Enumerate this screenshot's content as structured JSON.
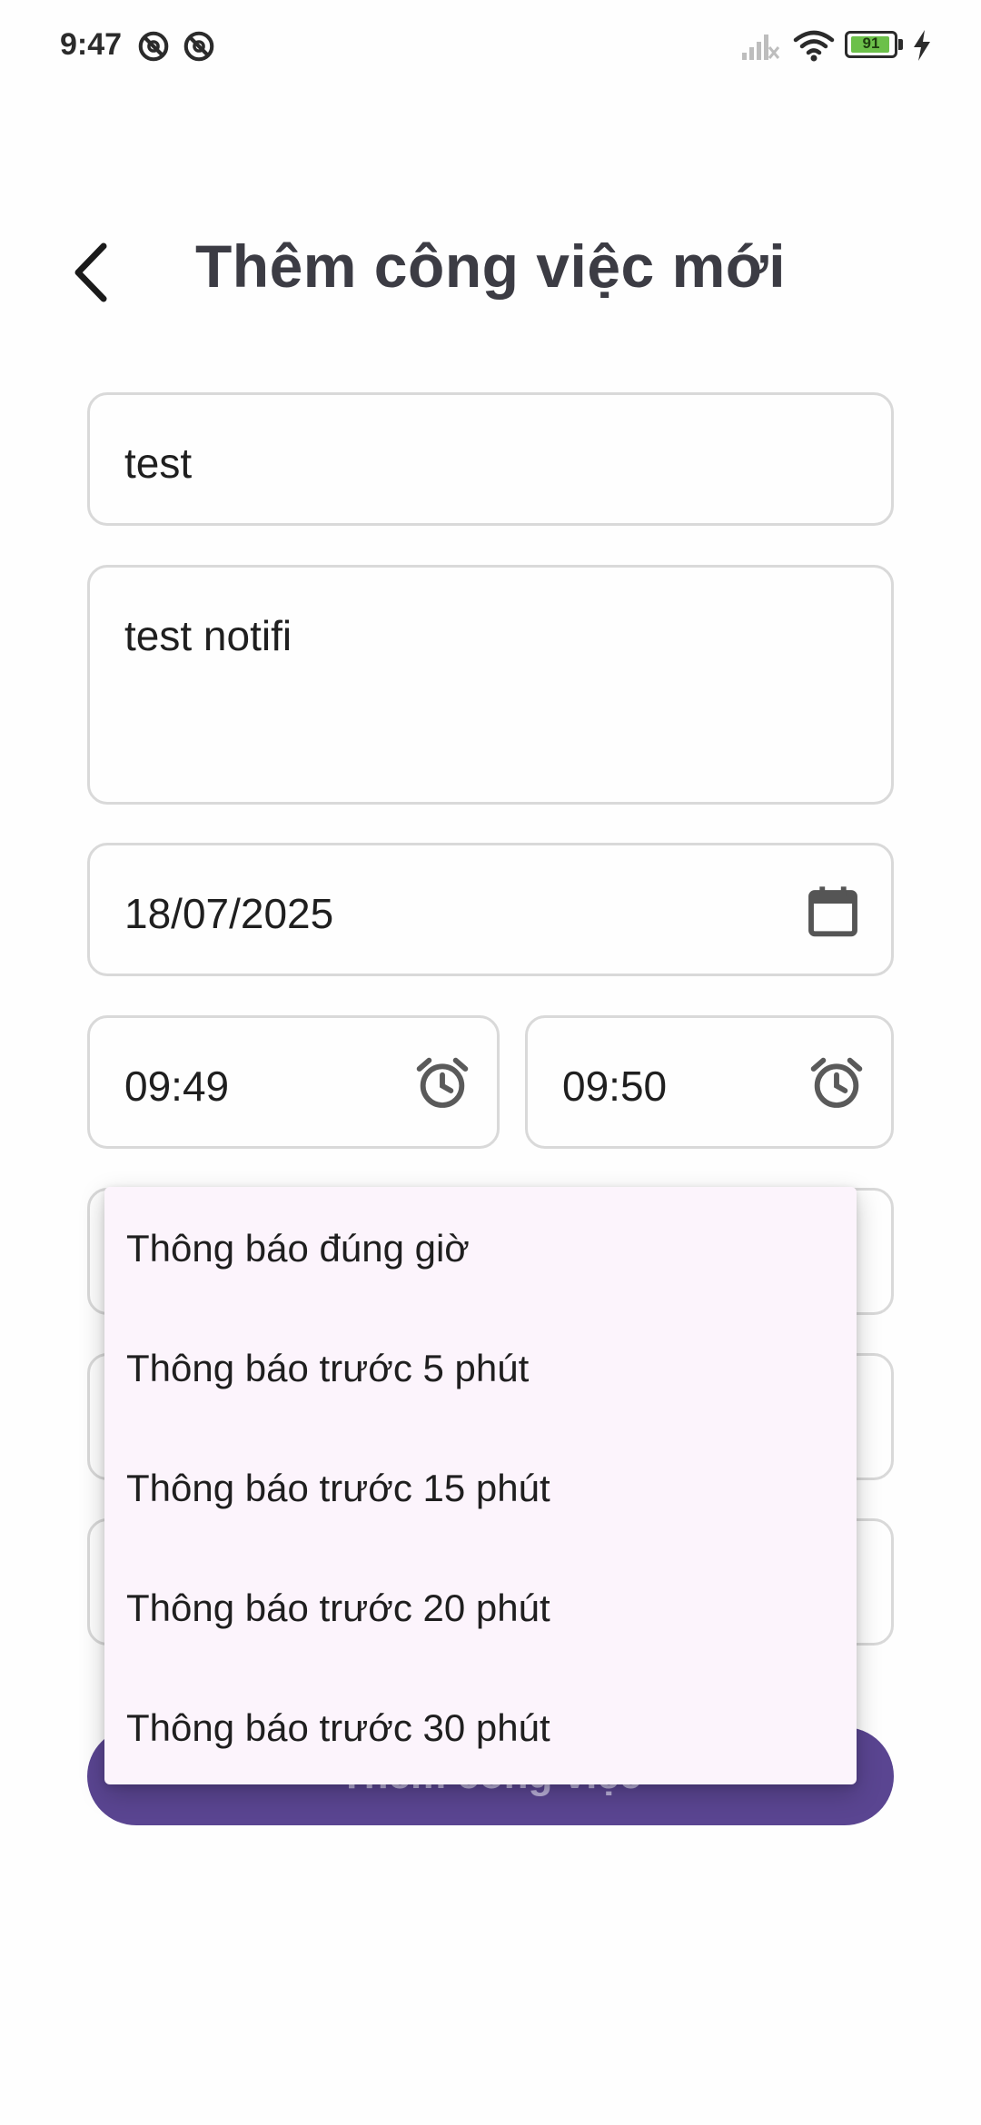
{
  "status_bar": {
    "time": "9:47",
    "battery_level": "91",
    "battery_fraction": 0.91,
    "notification_icons": [
      "blocked-notification-icon",
      "blocked-notification-icon"
    ],
    "right_icons": [
      "signal-off-icon",
      "wifi-icon",
      "battery-icon",
      "charging-bolt-icon"
    ]
  },
  "header": {
    "title": "Thêm công việc mới",
    "back_icon": "chevron-left-icon"
  },
  "form": {
    "title_value": "test",
    "description_value": "test notifi",
    "date_value": "18/07/2025",
    "date_icon": "calendar-icon",
    "start_time_value": "09:49",
    "end_time_value": "09:50",
    "time_icon": "alarm-clock-icon"
  },
  "submit_button": {
    "label": "Thêm công việc"
  },
  "reminder_menu": {
    "options": [
      "Thông báo đúng giờ",
      "Thông báo trước 5 phút",
      "Thông báo trước 15 phút",
      "Thông báo trước 20 phút",
      "Thông báo trước 30 phút"
    ]
  },
  "colors": {
    "primary": "#5a4591",
    "menu_background": "#fcf4fc",
    "field_border": "#d9d9d9",
    "title_text": "#3c3c44",
    "battery_fill": "#6cc04a"
  }
}
